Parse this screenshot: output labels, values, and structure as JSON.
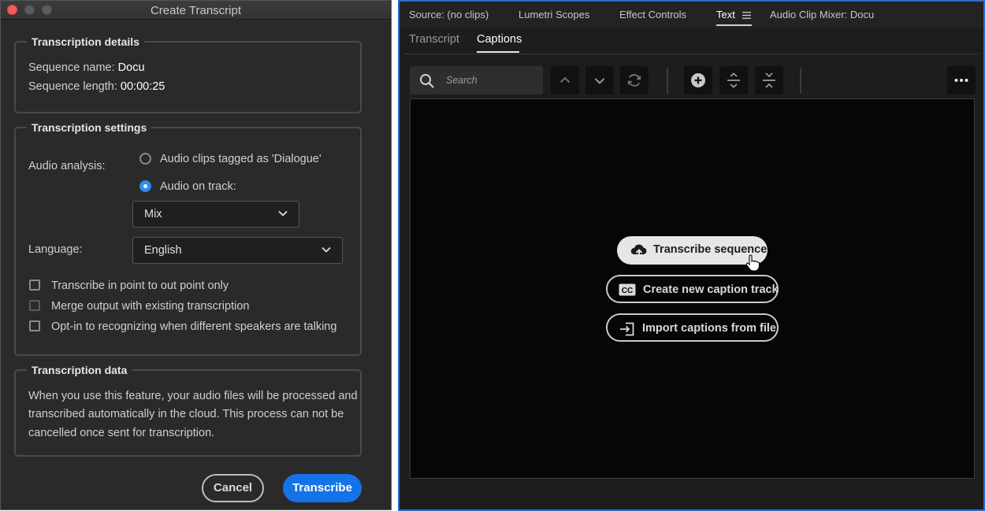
{
  "dialog": {
    "title": "Create Transcript",
    "details": {
      "legend": "Transcription details",
      "sequence_name_label": "Sequence name:",
      "sequence_name_value": "Docu",
      "sequence_length_label": "Sequence length:",
      "sequence_length_value": "00:00:25"
    },
    "settings": {
      "legend": "Transcription settings",
      "audio_analysis_label": "Audio analysis:",
      "radio_dialogue": "Audio clips tagged as 'Dialogue'",
      "radio_track": "Audio on track:",
      "track_select_value": "Mix",
      "language_label": "Language:",
      "language_value": "English",
      "check_in_out": "Transcribe in point to out point only",
      "check_merge": "Merge output with existing transcription",
      "check_speakers": "Opt-in to recognizing when different speakers are talking"
    },
    "data": {
      "legend": "Transcription data",
      "line1": "When you use this feature, your audio files will be processed and",
      "line2": "transcribed automatically in the cloud. This process can not be",
      "line3": "cancelled once sent for transcription."
    },
    "cancel_label": "Cancel",
    "transcribe_label": "Transcribe"
  },
  "panel": {
    "tabs": [
      "Source: (no clips)",
      "Lumetri Scopes",
      "Effect Controls",
      "Text",
      "Audio Clip Mixer: Docu"
    ],
    "subtabs": [
      "Transcript",
      "Captions"
    ],
    "search_placeholder": "Search",
    "transcribe_sequence_label": "Transcribe sequence",
    "new_caption_label": "Create new caption track",
    "import_captions_label": "Import captions from file",
    "cc_badge": "CC"
  },
  "colors": {
    "accent": "#1473e6",
    "radio_selected": "#2d8ceb",
    "panel_focus_border": "#2d6cc9"
  }
}
